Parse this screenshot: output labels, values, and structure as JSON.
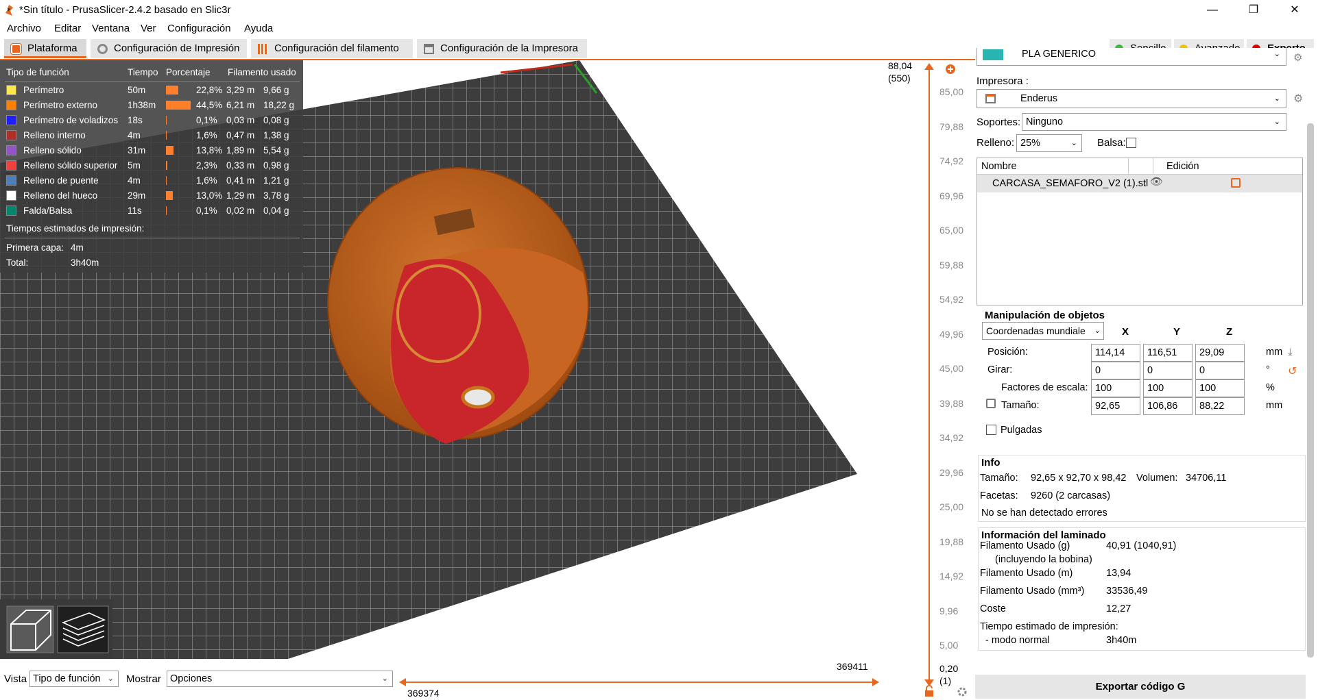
{
  "window": {
    "title": "*Sin título - PrusaSlicer-2.4.2 basado en Slic3r",
    "minimize": "—",
    "restore": "❐",
    "close": "✕"
  },
  "menu": [
    "Archivo",
    "Editar",
    "Ventana",
    "Ver",
    "Configuración",
    "Ayuda"
  ],
  "tabs": [
    "Plataforma",
    "Configuración de Impresión",
    "Configuración del filamento",
    "Configuración de la Impresora"
  ],
  "modes": [
    {
      "label": "Sencillo",
      "color": "#3dbb3d"
    },
    {
      "label": "Avanzado",
      "color": "#f2c400"
    },
    {
      "label": "Experto",
      "color": "#e00000"
    }
  ],
  "legend": {
    "headers": [
      "Tipo de función",
      "Tiempo",
      "Porcentaje",
      "Filamento usado"
    ],
    "rows": [
      {
        "name": "Perímetro",
        "color": "#ffe64d",
        "time": "50m",
        "pct": "22,8%",
        "pct_value": 22.8,
        "m": "3,29 m",
        "g": "9,66 g"
      },
      {
        "name": "Perímetro externo",
        "color": "#ff7f00",
        "time": "1h38m",
        "pct": "44,5%",
        "pct_value": 44.5,
        "m": "6,21 m",
        "g": "18,22 g"
      },
      {
        "name": "Perímetro de voladizos",
        "color": "#1f1fff",
        "time": "18s",
        "pct": "0,1%",
        "pct_value": 0.1,
        "m": "0,03 m",
        "g": "0,08 g"
      },
      {
        "name": "Relleno interno",
        "color": "#b03029",
        "time": "4m",
        "pct": "1,6%",
        "pct_value": 1.6,
        "m": "0,47 m",
        "g": "1,38 g"
      },
      {
        "name": "Relleno sólido",
        "color": "#9654cc",
        "time": "31m",
        "pct": "13,8%",
        "pct_value": 13.8,
        "m": "1,89 m",
        "g": "5,54 g"
      },
      {
        "name": "Relleno sólido superior",
        "color": "#f04040",
        "time": "5m",
        "pct": "2,3%",
        "pct_value": 2.3,
        "m": "0,33 m",
        "g": "0,98 g"
      },
      {
        "name": "Relleno de puente",
        "color": "#4d80ba",
        "time": "4m",
        "pct": "1,6%",
        "pct_value": 1.6,
        "m": "0,41 m",
        "g": "1,21 g"
      },
      {
        "name": "Relleno del hueco",
        "color": "#ffffff",
        "time": "29m",
        "pct": "13,0%",
        "pct_value": 13.0,
        "m": "1,29 m",
        "g": "3,78 g"
      },
      {
        "name": "Falda/Balsa",
        "color": "#00876e",
        "time": "11s",
        "pct": "0,1%",
        "pct_value": 0.1,
        "m": "0,02 m",
        "g": "0,04 g"
      }
    ],
    "times_title": "Tiempos estimados de impresión:",
    "first_layer_label": "Primera capa:",
    "first_layer": "4m",
    "total_label": "Total:",
    "total": "3h40m"
  },
  "bottom": {
    "view_label": "Vista",
    "view_value": "Tipo de función",
    "show_label": "Mostrar",
    "show_value": "Opciones",
    "slider_right": "369411",
    "slider_left": "369374"
  },
  "vslider": {
    "top_value": "88,04",
    "top_layer": "(550)",
    "ticks": [
      "85,00",
      "79,88",
      "74,92",
      "69,96",
      "65,00",
      "59,88",
      "54,92",
      "49,96",
      "45,00",
      "39,88",
      "34,92",
      "29,96",
      "25,00",
      "19,88",
      "14,92",
      "9,96",
      "5,00"
    ],
    "bottom_value": "0,20",
    "bottom_layer": "(1)"
  },
  "sidebar": {
    "filament": "PLA GENERICO",
    "filament_color": "#2ab3b3",
    "printer_label": "Impresora :",
    "printer": "Enderus",
    "supports_label": "Soportes:",
    "supports": "Ninguno",
    "infill_label": "Relleno:",
    "infill": "25%",
    "raft_label": "Balsa:",
    "objects_headers": [
      "Nombre",
      "Edición"
    ],
    "object_name": "CARCASA_SEMAFORO_V2 (1).stl",
    "manip_title": "Manipulación de objetos",
    "coords": "Coordenadas mundiale",
    "axes": [
      "X",
      "Y",
      "Z"
    ],
    "position_label": "Posición:",
    "position": [
      "114,14",
      "116,51",
      "29,09"
    ],
    "position_unit": "mm",
    "rotate_label": "Girar:",
    "rotate": [
      "0",
      "0",
      "0"
    ],
    "rotate_unit": "°",
    "scale_label": "Factores de escala:",
    "scale": [
      "100",
      "100",
      "100"
    ],
    "scale_unit": "%",
    "size_label": "Tamaño:",
    "size": [
      "92,65",
      "106,86",
      "88,22"
    ],
    "size_unit": "mm",
    "inches_label": "Pulgadas",
    "info_title": "Info",
    "info_size_label": "Tamaño:",
    "info_size": "92,65 x 92,70 x 98,42",
    "info_volume_label": "Volumen:",
    "info_volume": "34706,11",
    "info_facets_label": "Facetas:",
    "info_facets": "9260 (2 carcasas)",
    "info_errors": "No se han detectado errores",
    "slice_title": "Información del laminado",
    "slice_rows": [
      {
        "label": "Filamento Usado (g)",
        "value": "40,91 (1040,91)"
      },
      {
        "label": "(incluyendo la bobina)",
        "value": ""
      },
      {
        "label": "Filamento Usado (m)",
        "value": "13,94"
      },
      {
        "label": "Filamento Usado (mm³)",
        "value": "33536,49"
      },
      {
        "label": "Coste",
        "value": "12,27"
      },
      {
        "label": "Tiempo estimado de impresión:",
        "value": ""
      },
      {
        "label": "- modo normal",
        "value": "3h40m"
      }
    ],
    "export_label": "Exportar código G"
  }
}
